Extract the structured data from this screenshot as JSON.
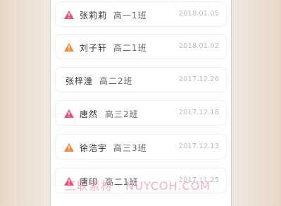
{
  "students": [
    {
      "name": "张莉莉",
      "class": "高一1班",
      "date": "2018.01.05",
      "alert": "red"
    },
    {
      "name": "刘子轩",
      "class": "高二1班",
      "date": "2018.01.02",
      "alert": "orange"
    },
    {
      "name": "张梓潼",
      "class": "高二2班",
      "date": "2017.12.26",
      "alert": "none"
    },
    {
      "name": "唐然",
      "class": "高三2班",
      "date": "2017.12.18",
      "alert": "red"
    },
    {
      "name": "徐浩宇",
      "class": "高三3班",
      "date": "2017.12.13",
      "alert": "orange"
    },
    {
      "name": "唐印",
      "class": "高二1班",
      "date": "2017.11.25",
      "alert": "red"
    }
  ],
  "colors": {
    "alert_red": "#f0506e",
    "alert_orange": "#f5873a"
  },
  "watermark": "三联素材 · NUYCOH.COM"
}
